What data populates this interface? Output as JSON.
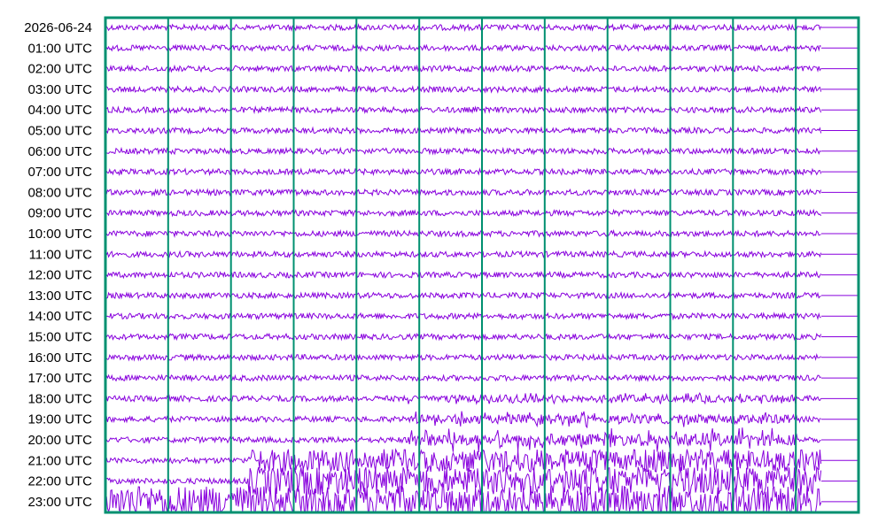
{
  "chart_data": {
    "type": "line",
    "title": "",
    "row_labels": [
      "2026-06-24",
      "01:00 UTC",
      "02:00 UTC",
      "03:00 UTC",
      "04:00 UTC",
      "05:00 UTC",
      "06:00 UTC",
      "07:00 UTC",
      "08:00 UTC",
      "09:00 UTC",
      "10:00 UTC",
      "11:00 UTC",
      "12:00 UTC",
      "13:00 UTC",
      "14:00 UTC",
      "15:00 UTC",
      "16:00 UTC",
      "17:00 UTC",
      "18:00 UTC",
      "19:00 UTC",
      "20:00 UTC",
      "21:00 UTC",
      "22:00 UTC",
      "23:00 UTC"
    ],
    "vertical_grid_lines": 12,
    "grid": true,
    "trace_color": "#8800dd",
    "grid_color": "#009070",
    "description_of_activity": {
      "quiet_rows": "00:00 through 17:00 UTC show low-amplitude background noise",
      "burst_onset_row": "18:00 UTC",
      "strongest_rows": [
        "21:00 UTC",
        "22:00 UTC",
        "23:00 UTC"
      ]
    },
    "row_amplitude": [
      1,
      1,
      1,
      1,
      1,
      1,
      1,
      1,
      1,
      1,
      1,
      1,
      1,
      1,
      1,
      1,
      1,
      1,
      1.4,
      1.8,
      2.5,
      4,
      5,
      6
    ]
  }
}
